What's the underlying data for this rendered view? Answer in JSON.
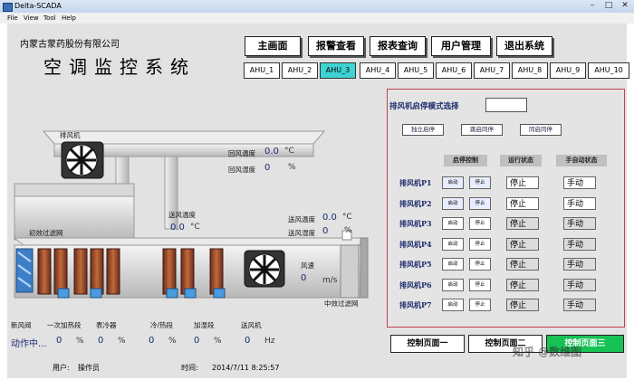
{
  "window": {
    "title": "Delta-SCADA"
  },
  "menu": [
    "File",
    "View",
    "Tool",
    "Help"
  ],
  "header": {
    "company": "内蒙古蒙药股份有限公司",
    "system_name": "空调监控系统"
  },
  "nav": [
    "主画面",
    "报警查看",
    "报表查询",
    "用户管理",
    "退出系统"
  ],
  "ahu_tabs": [
    "AHU_1",
    "AHU_2",
    "AHU_3",
    "AHU_4",
    "AHU_5",
    "AHU_6",
    "AHU_7",
    "AHU_8",
    "AHU_9",
    "AHU_10"
  ],
  "active_ahu": "AHU_3",
  "schematic": {
    "exhaust_fan_label": "排风机",
    "return_temp_label": "回风温度",
    "return_temp_value": "0.0",
    "return_temp_unit": "°C",
    "return_hum_label": "回风湿度",
    "return_hum_value": "0",
    "return_hum_unit": "%",
    "supply_temp_label": "送风温度",
    "supply_temp_value": "0.0",
    "supply_temp_unit": "°C",
    "air_temp_label": "送风温度",
    "air_temp_value": "0.0",
    "air_temp_unit": "°C",
    "air_hum_label": "送风湿度",
    "air_hum_value": "0",
    "air_hum_unit": "%",
    "primary_filter_label": "初效过滤网",
    "mid_filter_label": "中效过滤网",
    "wind_speed_label": "风速",
    "wind_speed_value": "0",
    "wind_speed_unit": "m/s",
    "bottom_labels": [
      "新风阀",
      "一次加热段",
      "表冷器",
      "冷/热段",
      "加湿段",
      "送风机"
    ],
    "bottom_values": [
      {
        "v": "动作中...",
        "u": ""
      },
      {
        "v": "0",
        "u": "%"
      },
      {
        "v": "0",
        "u": "%"
      },
      {
        "v": "0",
        "u": "%"
      },
      {
        "v": "0",
        "u": "%"
      },
      {
        "v": "0",
        "u": "Hz"
      }
    ]
  },
  "control": {
    "mode_label": "排风机启停模式选择",
    "mode_value": "",
    "mode_buttons": [
      "独立启停",
      "跳启同停",
      "同启同停"
    ],
    "col_headers": [
      "启停控制",
      "运行状态",
      "手自动状态"
    ],
    "start_label": "启动",
    "stop_label": "停止",
    "fans": [
      {
        "name": "排风机P1",
        "state": "停止",
        "mode": "手动"
      },
      {
        "name": "排风机P2",
        "state": "停止",
        "mode": "手动"
      },
      {
        "name": "排风机P3",
        "state": "停止",
        "mode": "手动"
      },
      {
        "name": "排风机P4",
        "state": "停止",
        "mode": "手动"
      },
      {
        "name": "排风机P5",
        "state": "停止",
        "mode": "手动"
      },
      {
        "name": "排风机P6",
        "state": "停止",
        "mode": "手动"
      },
      {
        "name": "排风机P7",
        "state": "停止",
        "mode": "手动"
      }
    ]
  },
  "pages": [
    "控制页面一",
    "控制页面二",
    "控制页面三"
  ],
  "status": {
    "user_label": "用户:",
    "user_value": "操作员",
    "time_label": "时间:",
    "time_value": "2014/7/11 8:25:57"
  },
  "watermark": "知乎 @数维图",
  "colors": {
    "active_tab": "#3fd3d3",
    "page3": "#17c255",
    "control_border": "#c04050"
  }
}
